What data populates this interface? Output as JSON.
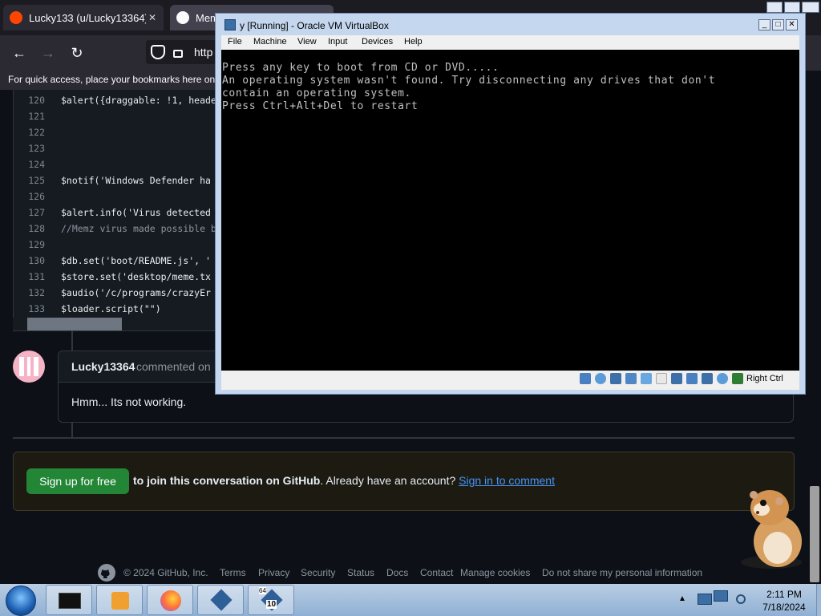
{
  "browser": {
    "tabs": [
      {
        "label": "Lucky133 (u/Lucky13364) - R"
      },
      {
        "label": "Mem"
      }
    ],
    "url": "http",
    "bookmarks_hint": "For quick access, place your bookmarks here on t"
  },
  "code": {
    "lines": [
      {
        "num": "120",
        "text": "$alert({draggable: !1, heade",
        "comment": false
      },
      {
        "num": "121",
        "text": "",
        "comment": false
      },
      {
        "num": "122",
        "text": "",
        "comment": false
      },
      {
        "num": "123",
        "text": "",
        "comment": false
      },
      {
        "num": "124",
        "text": "",
        "comment": false
      },
      {
        "num": "125",
        "text": "$notif('Windows Defender ha",
        "comment": false
      },
      {
        "num": "126",
        "text": "",
        "comment": false
      },
      {
        "num": "127",
        "text": "$alert.info('Virus detected",
        "comment": false
      },
      {
        "num": "128",
        "text": "//Memz virus made possible b",
        "comment": true
      },
      {
        "num": "129",
        "text": "",
        "comment": false
      },
      {
        "num": "130",
        "text": "$db.set('boot/README.js', '",
        "comment": false
      },
      {
        "num": "131",
        "text": "$store.set('desktop/meme.tx",
        "comment": false
      },
      {
        "num": "132",
        "text": "$audio('/c/programs/crazyEr",
        "comment": false
      },
      {
        "num": "133",
        "text": "$loader.script(\"\")",
        "comment": false
      }
    ]
  },
  "comment": {
    "username": "Lucky13364",
    "meta": "commented on",
    "body": "Hmm... Its not working."
  },
  "signup": {
    "button": "Sign up for free",
    "text_bold": "to join this conversation on GitHub",
    "text_rest": ". Already have an account?",
    "link": "Sign in to comment"
  },
  "footer": {
    "copyright": "© 2024 GitHub, Inc.",
    "links": [
      "Terms",
      "Privacy",
      "Security",
      "Status",
      "Docs",
      "Contact",
      "Manage cookies",
      "Do not share my personal information"
    ]
  },
  "vbox": {
    "title": "y [Running] - Oracle VM VirtualBox",
    "menu": [
      "File",
      "Machine",
      "View",
      "Input",
      "Devices",
      "Help"
    ],
    "console": [
      "Press any key to boot from CD or DVD.....",
      "An operating system wasn't found. Try disconnecting any drives that don't",
      "contain an operating system.",
      "Press Ctrl+Alt+Del to restart"
    ],
    "host_key": "Right Ctrl",
    "status_icons": [
      "hard-disk-icon",
      "optical-drive-icon",
      "audio-icon",
      "network-icon",
      "usb-icon",
      "shared-folder-icon",
      "display-icon",
      "video-capture-icon",
      "cpu-icon",
      "mouse-integration-icon",
      "host-key-icon"
    ]
  },
  "taskbar": {
    "buttons": [
      "terminal-icon",
      "media-player-icon",
      "firefox-icon",
      "virtualbox-icon",
      "virtualbox-64-icon"
    ],
    "pinned_badge": "10",
    "badge_top": "64",
    "time": "2:11 PM",
    "date": "7/18/2024"
  }
}
